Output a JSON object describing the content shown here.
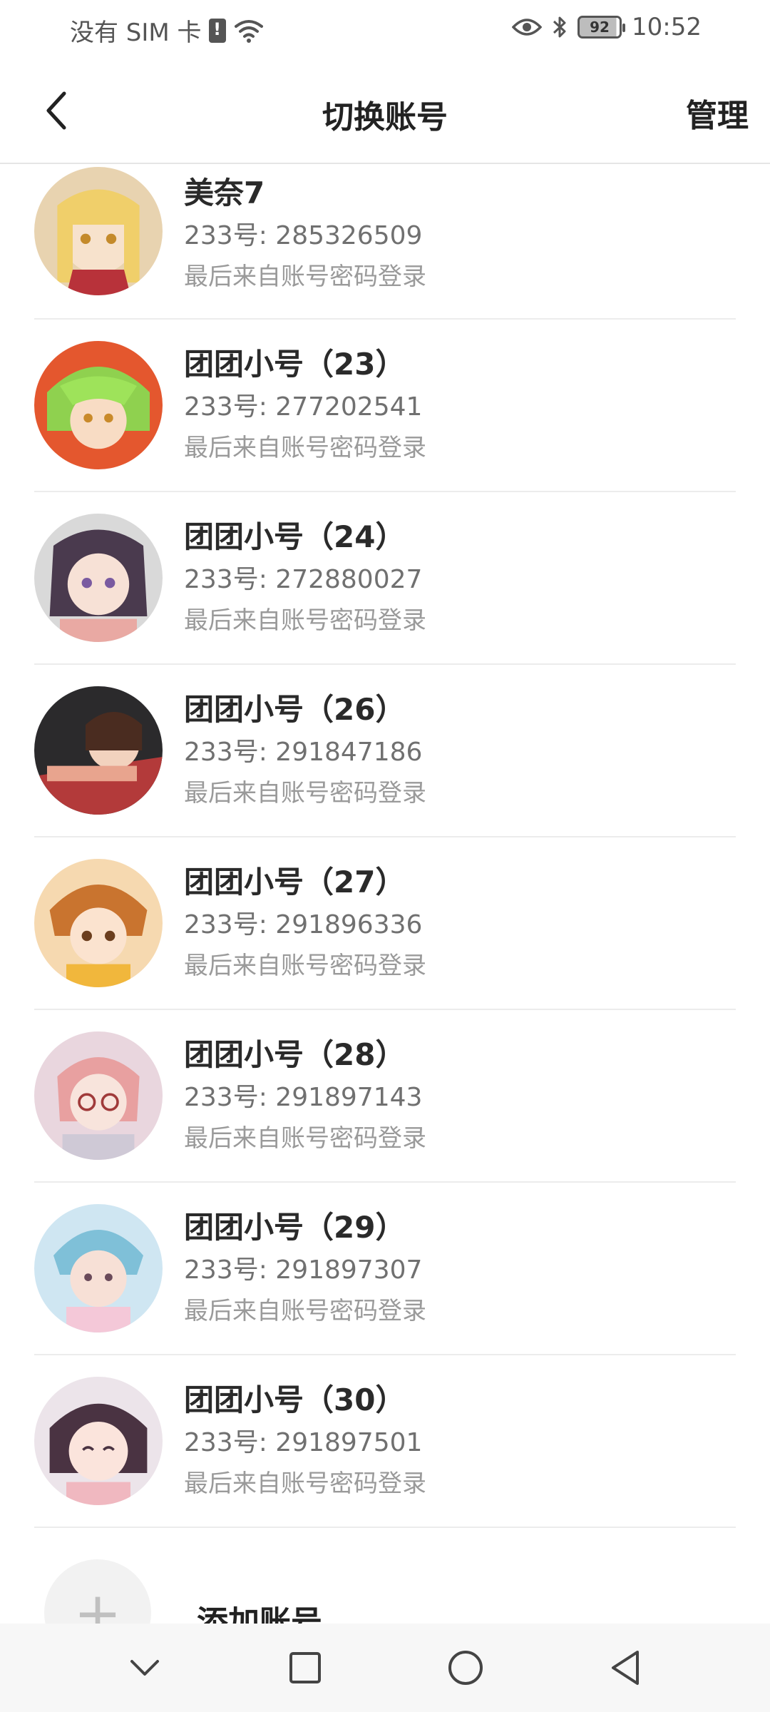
{
  "status_bar": {
    "carrier": "没有 SIM 卡",
    "battery": "92",
    "time": "10:52"
  },
  "header": {
    "title": "切换账号",
    "manage_label": "管理"
  },
  "accounts": [
    {
      "name": "美奈7",
      "uid": "233号: 285326509",
      "last_login": "最后来自账号密码登录"
    },
    {
      "name": "团团小号（23）",
      "uid": "233号: 277202541",
      "last_login": "最后来自账号密码登录"
    },
    {
      "name": "团团小号（24）",
      "uid": "233号: 272880027",
      "last_login": "最后来自账号密码登录"
    },
    {
      "name": "团团小号（26）",
      "uid": "233号: 291847186",
      "last_login": "最后来自账号密码登录"
    },
    {
      "name": "团团小号（27）",
      "uid": "233号: 291896336",
      "last_login": "最后来自账号密码登录"
    },
    {
      "name": "团团小号（28）",
      "uid": "233号: 291897143",
      "last_login": "最后来自账号密码登录"
    },
    {
      "name": "团团小号（29）",
      "uid": "233号: 291897307",
      "last_login": "最后来自账号密码登录"
    },
    {
      "name": "团团小号（30）",
      "uid": "233号: 291897501",
      "last_login": "最后来自账号密码登录"
    }
  ],
  "add_account": {
    "icon": "plus-icon",
    "label": "添加账号"
  },
  "nav": {
    "icons": [
      "chevron-down-icon",
      "recents-square-icon",
      "home-circle-icon",
      "back-triangle-icon"
    ]
  },
  "colors": {
    "text_primary": "#222222",
    "text_secondary": "#707070",
    "text_tertiary": "#9a9a9a",
    "divider": "#ececec"
  }
}
